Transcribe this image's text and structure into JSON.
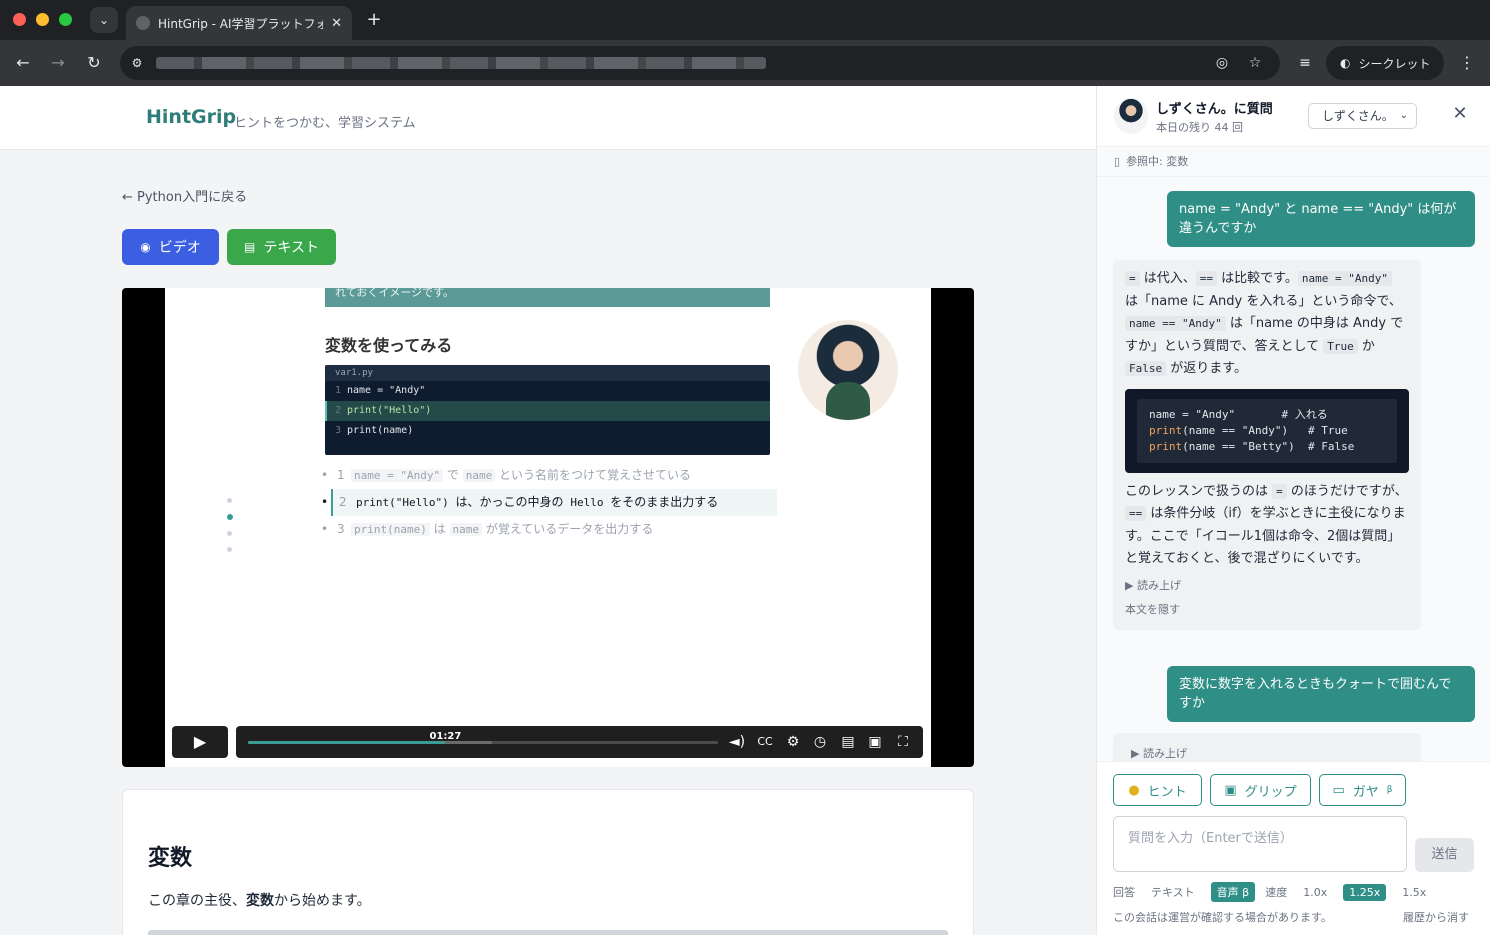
{
  "browser": {
    "tab_title": "HintGrip - AI学習プラットフォーム",
    "incognito_label": "シークレット"
  },
  "site": {
    "brand": "HintGrip",
    "tagline": "ヒントをつかむ、学習システム"
  },
  "lesson": {
    "back_link": "← Python入門に戻る",
    "video_button": "ビデオ",
    "text_button": "テキスト"
  },
  "slide": {
    "band_text": "れておくイメージです。",
    "heading": "変数を使ってみる",
    "code_file": "var1.py",
    "code_lines": [
      {
        "num": "1",
        "text": "name = \"Andy\""
      },
      {
        "num": "2",
        "text": "print(\"Hello\")"
      },
      {
        "num": "3",
        "text": "print(name)"
      }
    ],
    "bullets": [
      {
        "num": "1",
        "code1": "name = \"Andy\"",
        "mid": " で ",
        "code2": "name",
        "rest": " という名前をつけて覚えさせている"
      },
      {
        "num": "2",
        "code1": "print(\"Hello\")",
        "mid": " は、かっこの中身の ",
        "code2": "Hello",
        "rest": " をそのまま出力する"
      },
      {
        "num": "3",
        "code1": "print(name)",
        "mid": " は ",
        "code2": "name",
        "rest": " が覚えているデータを出力する"
      }
    ]
  },
  "player": {
    "time": "01:27",
    "progress": 0.42,
    "buffered": 0.52
  },
  "article": {
    "title": "変数",
    "lead_prefix": "この章の主役、",
    "lead_bold": "変数",
    "lead_suffix": "から始めます。"
  },
  "chat": {
    "title": "しずくさん。に質問",
    "remaining": "本日の残り 44 回",
    "persona_select": "しずくさん。",
    "reference": "参照中: 変数",
    "messages": {
      "user1": "name = \"Andy\" と name == \"Andy\" は何が違うんですか",
      "bot1": {
        "p1_c1": "=",
        "p1_t1": " は代入、",
        "p1_c2": "==",
        "p1_t2": " は比較です。",
        "p1_c3": "name = \"Andy\"",
        "p1_t3": " は「name に Andy を入れる」という命令で、",
        "p1_c4": "name == \"Andy\"",
        "p1_t4": " は「name の中身は Andy ですか」という質問で、答えとして ",
        "p1_c5": "True",
        "p1_t5": " か ",
        "p1_c6": "False",
        "p1_t6": " が返ります。",
        "code": {
          "l1": "name = \"Andy\"       # 入れる",
          "l2_fn": "print",
          "l2_rest": "(name == \"Andy\")   # True",
          "l3_fn": "print",
          "l3_rest": "(name == \"Betty\")  # False"
        },
        "p2_t1": "このレッスンで扱うのは ",
        "p2_c1": "=",
        "p2_t2": " のほうだけですが、",
        "p2_c2": "==",
        "p2_t3": " は条件分岐（if）を学ぶときに主役になります。ここで「イコール1個は命令、2個は質問」と覚えておくと、後で混ざりにくいです。",
        "read_aloud": "▶ 読み上げ",
        "hide_body": "本文を隠す"
      },
      "user2": "変数に数字を入れるときもクォートで囲むんですか",
      "bot2_read_aloud": "▶ 読み上げ"
    },
    "actions": {
      "hint": "ヒント",
      "grip": "グリップ",
      "gaya": "ガヤ",
      "beta": "β"
    },
    "input_placeholder": "質問を入力（Enterで送信）",
    "send": "送信",
    "options": {
      "answer_label": "回答",
      "text": "テキスト",
      "voice": "音声 β",
      "speed_label": "速度",
      "speed_1": "1.0x",
      "speed_2": "1.25x",
      "speed_3": "1.5x"
    },
    "disclaimer": "この会話は運営が確認する場合があります。",
    "clear_history": "履歴から消す"
  }
}
